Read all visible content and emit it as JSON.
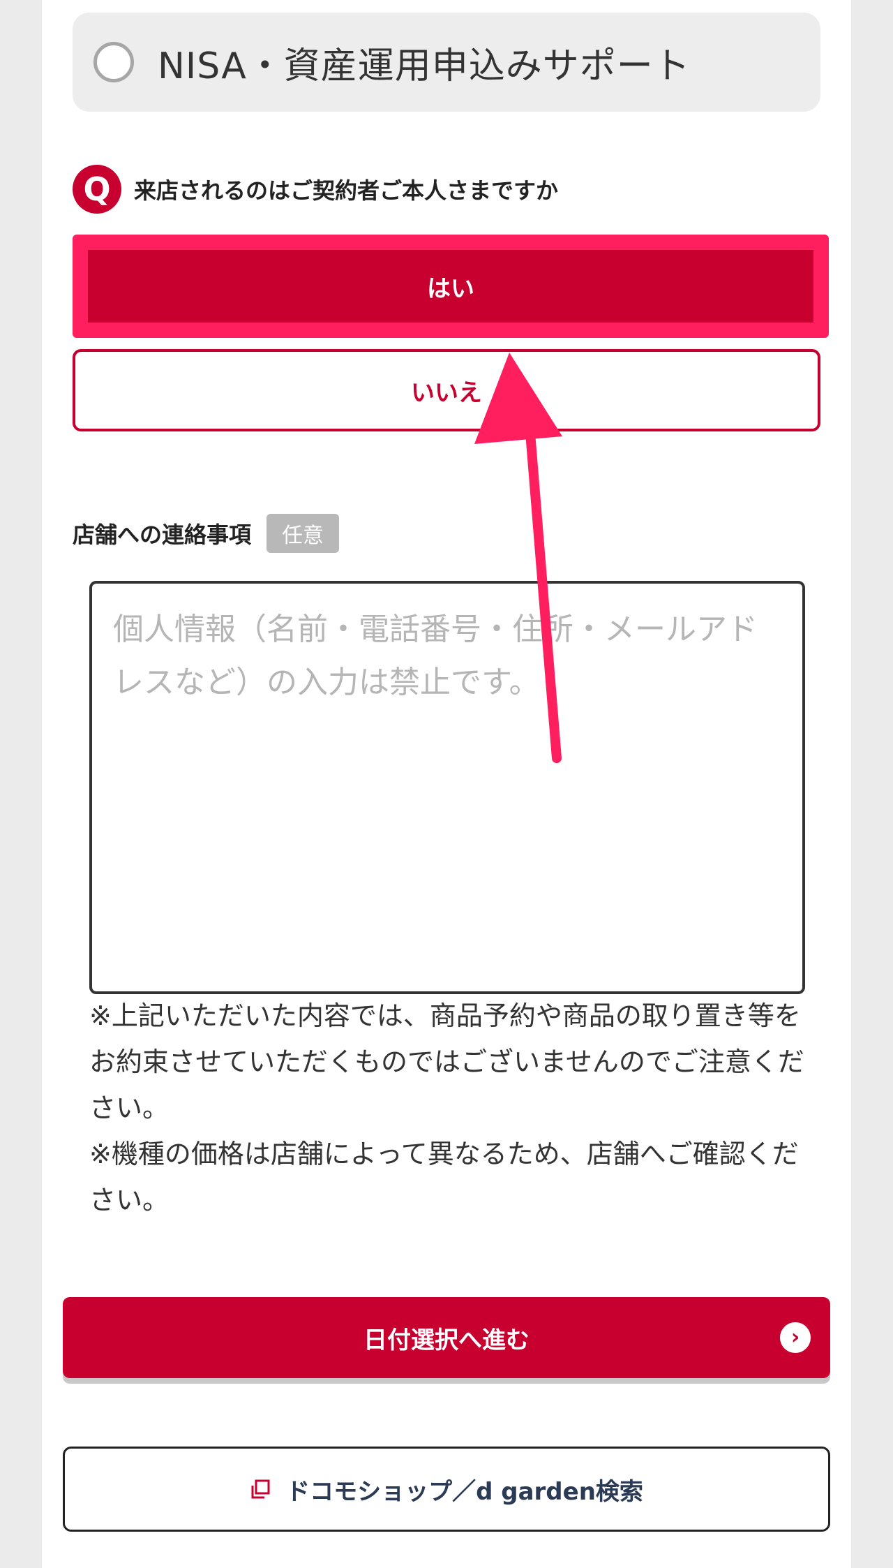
{
  "option": {
    "label": "NISA・資産運用申込みサポート"
  },
  "question": {
    "icon_letter": "Q",
    "text": "来店されるのはご契約者ご本人さまですか",
    "yes_label": "はい",
    "no_label": "いいえ"
  },
  "contact": {
    "title": "店舗への連絡事項",
    "badge": "任意",
    "placeholder": "個人情報（名前・電話番号・住所・メールアドレスなど）の入力は禁止です。"
  },
  "notes": [
    "※上記いただいた内容では、商品予約や商品の取り置き等をお約束させていただくものではございませんのでご注意ください。",
    "※機種の価格は店舗によって異なるため、店舗へご確認ください。"
  ],
  "buttons": {
    "next_label": "日付選択へ進む",
    "search_label": "ドコモショップ／d garden検索"
  },
  "colors": {
    "brand_red": "#c7002f",
    "highlight_pink": "#ff1f5e"
  },
  "icons": {
    "next": "chevron-right-circle-icon",
    "search": "external-link-icon"
  }
}
